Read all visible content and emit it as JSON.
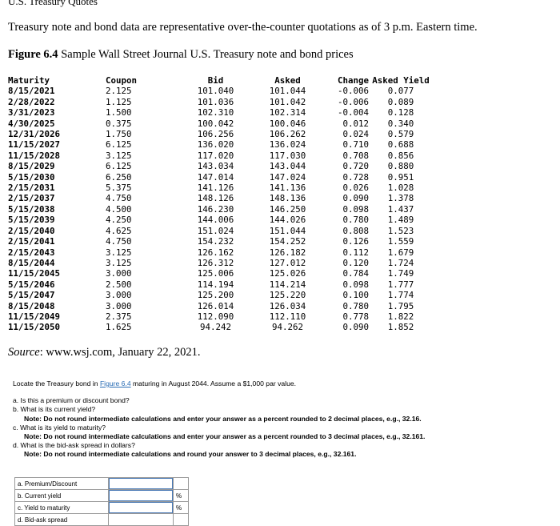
{
  "header": {
    "title": "U.S. Treasury Quotes",
    "intro": "Treasury note and bond data are representative over-the-counter quotations as of 3 p.m. Eastern time.",
    "figure_label": "Figure 6.4",
    "figure_title": " Sample Wall Street Journal U.S. Treasury note and bond prices"
  },
  "table": {
    "headers": [
      "Maturity",
      "Coupon",
      "Bid",
      "Asked",
      "Change",
      "Asked Yield"
    ],
    "rows": [
      [
        "8/15/2021",
        "2.125",
        "101.040",
        "101.044",
        "-0.006",
        "0.077"
      ],
      [
        "2/28/2022",
        "1.125",
        "101.036",
        "101.042",
        "-0.006",
        "0.089"
      ],
      [
        "3/31/2023",
        "1.500",
        "102.310",
        "102.314",
        "-0.004",
        "0.128"
      ],
      [
        "4/30/2025",
        "0.375",
        "100.042",
        "100.046",
        "0.012",
        "0.340"
      ],
      [
        "12/31/2026",
        "1.750",
        "106.256",
        "106.262",
        "0.024",
        "0.579"
      ],
      [
        "11/15/2027",
        "6.125",
        "136.020",
        "136.024",
        "0.710",
        "0.688"
      ],
      [
        "11/15/2028",
        "3.125",
        "117.020",
        "117.030",
        "0.708",
        "0.856"
      ],
      [
        "8/15/2029",
        "6.125",
        "143.034",
        "143.044",
        "0.720",
        "0.880"
      ],
      [
        "5/15/2030",
        "6.250",
        "147.014",
        "147.024",
        "0.728",
        "0.951"
      ],
      [
        "2/15/2031",
        "5.375",
        "141.126",
        "141.136",
        "0.026",
        "1.028"
      ],
      [
        "2/15/2037",
        "4.750",
        "148.126",
        "148.136",
        "0.090",
        "1.378"
      ],
      [
        "5/15/2038",
        "4.500",
        "146.230",
        "146.250",
        "0.098",
        "1.437"
      ],
      [
        "5/15/2039",
        "4.250",
        "144.006",
        "144.026",
        "0.780",
        "1.489"
      ],
      [
        "2/15/2040",
        "4.625",
        "151.024",
        "151.044",
        "0.808",
        "1.523"
      ],
      [
        "2/15/2041",
        "4.750",
        "154.232",
        "154.252",
        "0.126",
        "1.559"
      ],
      [
        "2/15/2043",
        "3.125",
        "126.162",
        "126.182",
        "0.112",
        "1.679"
      ],
      [
        "8/15/2044",
        "3.125",
        "126.312",
        "127.012",
        "0.120",
        "1.724"
      ],
      [
        "11/15/2045",
        "3.000",
        "125.006",
        "125.026",
        "0.784",
        "1.749"
      ],
      [
        "5/15/2046",
        "2.500",
        "114.194",
        "114.214",
        "0.098",
        "1.777"
      ],
      [
        "5/15/2047",
        "3.000",
        "125.200",
        "125.220",
        "0.100",
        "1.774"
      ],
      [
        "8/15/2048",
        "3.000",
        "126.014",
        "126.034",
        "0.780",
        "1.795"
      ],
      [
        "11/15/2049",
        "2.375",
        "112.090",
        "112.110",
        "0.778",
        "1.822"
      ],
      [
        "11/15/2050",
        "1.625",
        "94.242",
        "94.262",
        "0.090",
        "1.852"
      ]
    ]
  },
  "source": {
    "label": "Source",
    "text": ": www.wsj.com, January 22, 2021."
  },
  "question": {
    "lead_before": "Locate the Treasury bond in ",
    "lead_link": "Figure 6.4",
    "lead_after": " maturing in August 2044. Assume a $1,000 par value.",
    "items": [
      {
        "text": "a. Is this a premium or discount bond?",
        "note": ""
      },
      {
        "text": "b. What is its current yield?",
        "note": "Note: Do not round intermediate calculations and enter your answer as a percent rounded to 2 decimal places, e.g., 32.16."
      },
      {
        "text": "c. What is its yield to maturity?",
        "note": "Note: Do not round intermediate calculations and enter your answer as a percent rounded to 3 decimal places, e.g., 32.161."
      },
      {
        "text": "d. What is the bid-ask spread in dollars?",
        "note": "Note: Do not round intermediate calculations and round your answer to 3 decimal places, e.g., 32.161."
      }
    ]
  },
  "answers": [
    {
      "label": "a. Premium/Discount",
      "unit": ""
    },
    {
      "label": "b. Current yield",
      "unit": "%"
    },
    {
      "label": "c. Yield to maturity",
      "unit": "%"
    },
    {
      "label": "d. Bid-ask spread",
      "unit": ""
    }
  ]
}
